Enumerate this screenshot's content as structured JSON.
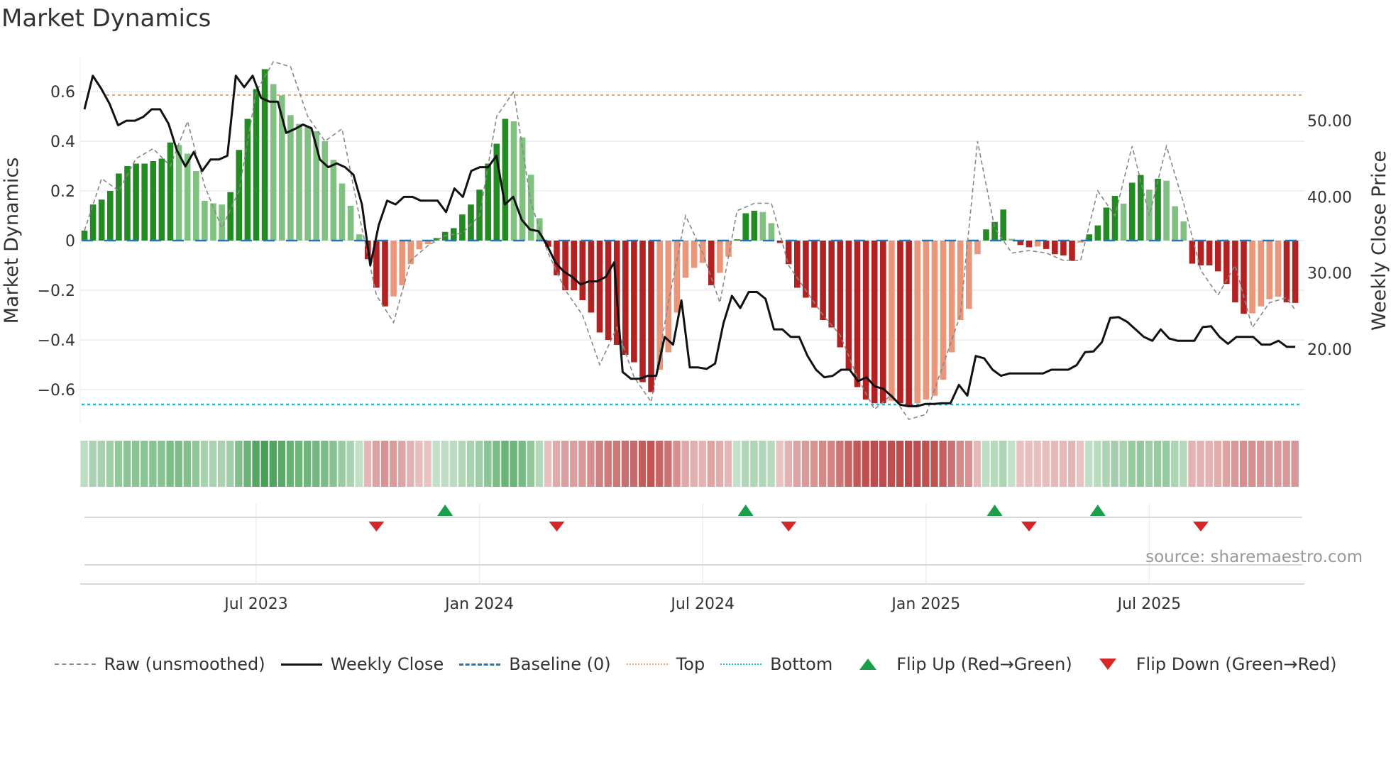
{
  "chart_data": {
    "type": "bar",
    "title": "Market Dynamics",
    "ylabel": "Market Dynamics",
    "y2label": "Weekly Close Price",
    "ylim": [
      -0.74,
      0.74
    ],
    "y2lim": [
      10.0,
      56.0
    ],
    "yticks": [
      {
        "v": 0.6,
        "label": "0.6"
      },
      {
        "v": 0.4,
        "label": "0.4"
      },
      {
        "v": 0.2,
        "label": "0.2"
      },
      {
        "v": 0,
        "label": "0"
      },
      {
        "v": -0.2,
        "label": "−0.2"
      },
      {
        "v": -0.4,
        "label": "−0.4"
      },
      {
        "v": -0.6,
        "label": "−0.6"
      }
    ],
    "y2ticks": [
      {
        "v": 50,
        "label": "50.00"
      },
      {
        "v": 40,
        "label": "40.00"
      },
      {
        "v": 30,
        "label": "30.00"
      },
      {
        "v": 20,
        "label": "20.00"
      }
    ],
    "xticks": [
      {
        "week": 20,
        "label": "Jul 2023"
      },
      {
        "week": 46,
        "label": "Jan 2024"
      },
      {
        "week": 72,
        "label": "Jul 2024"
      },
      {
        "week": 98,
        "label": "Jan 2025"
      },
      {
        "week": 124,
        "label": "Jul 2025"
      }
    ],
    "top": 0.586,
    "bottom": -0.66,
    "baseline": 0,
    "momentum": [
      0.04,
      0.145,
      0.165,
      0.2,
      0.27,
      0.3,
      0.31,
      0.31,
      0.32,
      0.33,
      0.395,
      0.385,
      0.35,
      0.28,
      0.16,
      0.15,
      0.145,
      0.195,
      0.365,
      0.49,
      0.61,
      0.69,
      0.63,
      0.585,
      0.505,
      0.47,
      0.46,
      0.44,
      0.4,
      0.325,
      0.23,
      0.14,
      0.025,
      -0.075,
      -0.19,
      -0.265,
      -0.225,
      -0.18,
      -0.095,
      -0.035,
      -0.015,
      0.01,
      0.035,
      0.05,
      0.105,
      0.145,
      0.205,
      0.31,
      0.39,
      0.49,
      0.48,
      0.415,
      0.265,
      0.09,
      -0.025,
      -0.14,
      -0.2,
      -0.2,
      -0.24,
      -0.29,
      -0.37,
      -0.4,
      -0.42,
      -0.46,
      -0.49,
      -0.57,
      -0.61,
      -0.52,
      -0.45,
      -0.29,
      -0.15,
      -0.11,
      -0.09,
      -0.18,
      -0.13,
      -0.065,
      0.005,
      0.11,
      0.12,
      0.115,
      0.07,
      -0.01,
      -0.095,
      -0.19,
      -0.23,
      -0.27,
      -0.32,
      -0.35,
      -0.43,
      -0.52,
      -0.59,
      -0.64,
      -0.655,
      -0.655,
      -0.645,
      -0.655,
      -0.665,
      -0.655,
      -0.64,
      -0.625,
      -0.56,
      -0.45,
      -0.32,
      -0.275,
      -0.055,
      0.045,
      0.075,
      0.125,
      0.007,
      -0.018,
      -0.027,
      -0.024,
      -0.034,
      -0.055,
      -0.06,
      -0.082,
      -0.008,
      0.025,
      0.061,
      0.133,
      0.18,
      0.149,
      0.233,
      0.264,
      0.205,
      0.249,
      0.241,
      0.138,
      0.077,
      -0.093,
      -0.1,
      -0.1,
      -0.124,
      -0.175,
      -0.249,
      -0.295,
      -0.293,
      -0.265,
      -0.236,
      -0.226,
      -0.249,
      -0.251
    ],
    "raw": {
      "weeks": [
        0,
        2,
        4,
        6,
        8,
        10,
        12,
        14,
        16,
        18,
        20,
        22,
        24,
        26,
        28,
        30,
        32,
        34,
        36,
        38,
        40,
        42,
        44,
        46,
        48,
        50,
        52,
        54,
        56,
        58,
        60,
        62,
        64,
        66,
        68,
        70,
        72,
        74,
        76,
        78,
        80,
        82,
        84,
        86,
        88,
        90,
        92,
        94,
        96,
        98,
        100,
        102,
        104,
        106,
        108,
        110,
        112,
        114,
        116,
        118,
        120,
        122,
        124,
        126,
        128,
        130,
        132,
        134,
        136,
        138,
        140,
        141
      ],
      "values": [
        0.04,
        0.25,
        0.2,
        0.33,
        0.37,
        0.3,
        0.48,
        0.22,
        0.05,
        0.2,
        0.6,
        0.72,
        0.7,
        0.5,
        0.4,
        0.45,
        0.1,
        -0.22,
        -0.33,
        -0.08,
        -0.02,
        0.02,
        0.03,
        0.1,
        0.5,
        0.6,
        0.15,
        -0.05,
        -0.2,
        -0.3,
        -0.5,
        -0.35,
        -0.55,
        -0.65,
        -0.25,
        0.1,
        -0.05,
        -0.25,
        0.12,
        0.15,
        0.15,
        -0.1,
        -0.2,
        -0.3,
        -0.38,
        -0.55,
        -0.68,
        -0.62,
        -0.72,
        -0.7,
        -0.5,
        -0.3,
        0.4,
        0.05,
        -0.05,
        -0.04,
        -0.05,
        -0.08,
        -0.08,
        0.2,
        0.1,
        0.38,
        0.1,
        0.38,
        0.15,
        -0.12,
        -0.22,
        -0.1,
        -0.35,
        -0.25,
        -0.23,
        -0.28
      ]
    },
    "weekly_close": [
      51.5,
      55.9,
      54.2,
      52.2,
      49.4,
      50,
      50,
      50.5,
      51.5,
      51.5,
      49.6,
      46.1,
      44,
      45.9,
      43.4,
      44.9,
      44.9,
      45.4,
      55.9,
      54.4,
      55.9,
      53,
      52.5,
      52.5,
      48.4,
      48.9,
      49.5,
      49,
      44.9,
      43.9,
      44.4,
      43.9,
      42.9,
      39,
      31,
      36.3,
      39.5,
      39,
      40,
      40,
      39.5,
      39.5,
      39.5,
      38,
      41.1,
      40,
      43.4,
      43.9,
      43.9,
      45.4,
      39,
      40,
      37,
      35.7,
      35.5,
      33.7,
      31.4,
      30.2,
      29.5,
      28.5,
      28.9,
      28.9,
      29.5,
      31.4,
      17,
      16.1,
      16.1,
      16.5,
      16.5,
      21.6,
      20.6,
      26.4,
      17.6,
      17.6,
      17.4,
      18.1,
      23.4,
      27,
      25.4,
      27.5,
      27.5,
      26.6,
      22.6,
      22.6,
      21.6,
      21.6,
      19.1,
      17.3,
      16.3,
      16.5,
      17.3,
      17.3,
      15.8,
      16.3,
      15.1,
      14.8,
      13.8,
      12.7,
      12.5,
      12.5,
      12.8,
      12.8,
      12.9,
      12.9,
      15.3,
      13.9,
      19.1,
      18.8,
      17.3,
      16.5,
      16.8,
      16.8,
      16.8,
      16.8,
      16.8,
      17.3,
      17.3,
      17.3,
      17.9,
      19.6,
      19.7,
      20.9,
      24.1,
      24.2,
      23.6,
      22.6,
      21.6,
      21.1,
      22.6,
      21.4,
      21.1,
      21.1,
      21.1,
      22.9,
      23,
      21.6,
      20.7,
      21.6,
      21.6,
      21.6,
      20.6,
      20.6,
      21.1,
      20.3,
      20.3
    ],
    "flips_up": [
      42,
      77,
      106,
      118
    ],
    "flips_down": [
      34,
      55,
      82,
      110,
      130
    ],
    "colors": {
      "green_dark": "#228b22",
      "green_light": "#80c080",
      "red_dark": "#b22222",
      "red_light": "#e9967a",
      "top": "#f4a460",
      "bottom": "#17becf",
      "baseline": "#1f77b4",
      "flip_up": "#1a9e4a",
      "flip_down": "#d62728"
    },
    "legend": [
      "Raw (unsmoothed)",
      "Weekly Close",
      "Baseline (0)",
      "Top",
      "Bottom",
      "Flip Up (Red→Green)",
      "Flip Down (Green→Red)"
    ],
    "source": "source: sharemaestro.com"
  }
}
